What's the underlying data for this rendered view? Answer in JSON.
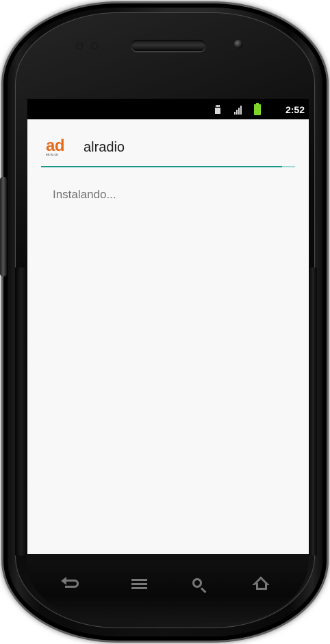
{
  "status_bar": {
    "time": "2:52",
    "usb_icon": "usb-icon",
    "signal_icon": "signal-icon",
    "battery_icon": "battery-icon"
  },
  "app": {
    "logo_text": "ad",
    "logo_tagline": "en tu co",
    "title": "alradio",
    "progress": {
      "value": 0.95,
      "track_color": "#9bd9d2",
      "fill_color": "#1b978c"
    },
    "message": "Instalando..."
  },
  "navigation": {
    "back_icon": "back-icon",
    "menu_icon": "menu-icon",
    "search_icon": "search-icon",
    "home_icon": "home-icon"
  }
}
